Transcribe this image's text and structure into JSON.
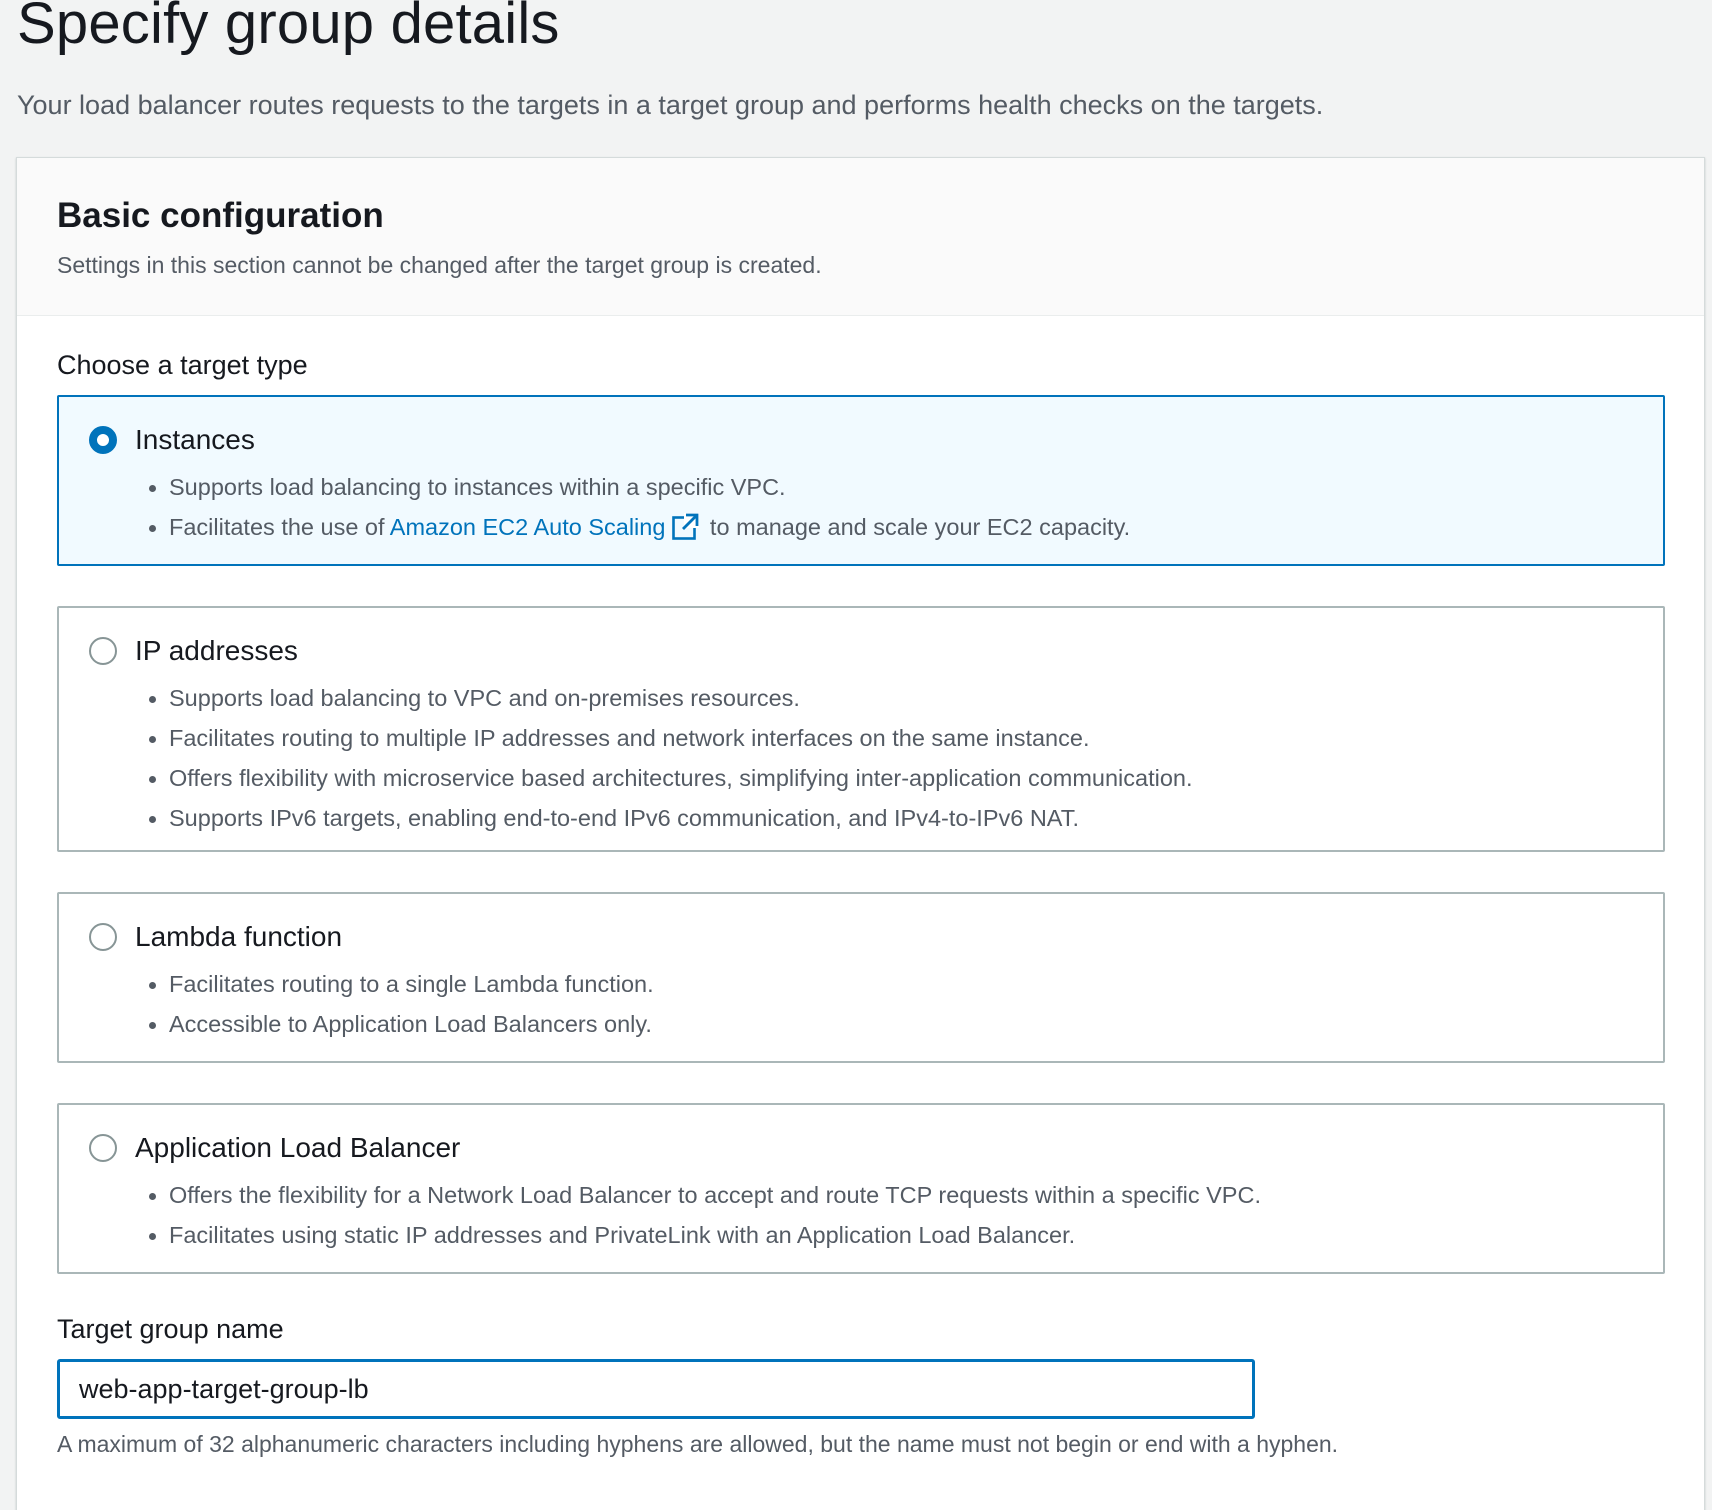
{
  "page": {
    "title": "Specify group details",
    "description": "Your load balancer routes requests to the targets in a target group and performs health checks on the targets."
  },
  "basic_config": {
    "title": "Basic configuration",
    "subtitle": "Settings in this section cannot be changed after the target group is created.",
    "target_type_label": "Choose a target type",
    "options": [
      {
        "title": "Instances",
        "selected": true,
        "bullets": [
          "Supports load balancing to instances within a specific VPC."
        ],
        "link_bullet": {
          "before": "Facilitates the use of ",
          "link": "Amazon EC2 Auto Scaling",
          "after": " to manage and scale your EC2 capacity."
        }
      },
      {
        "title": "IP addresses",
        "selected": false,
        "bullets": [
          "Supports load balancing to VPC and on-premises resources.",
          "Facilitates routing to multiple IP addresses and network interfaces on the same instance.",
          "Offers flexibility with microservice based architectures, simplifying inter-application communication.",
          "Supports IPv6 targets, enabling end-to-end IPv6 communication, and IPv4-to-IPv6 NAT."
        ]
      },
      {
        "title": "Lambda function",
        "selected": false,
        "bullets": [
          "Facilitates routing to a single Lambda function.",
          "Accessible to Application Load Balancers only."
        ]
      },
      {
        "title": "Application Load Balancer",
        "selected": false,
        "bullets": [
          "Offers the flexibility for a Network Load Balancer to accept and route TCP requests within a specific VPC.",
          "Facilitates using static IP addresses and PrivateLink with an Application Load Balancer."
        ]
      }
    ],
    "target_group_name_label": "Target group name",
    "target_group_name_value": "web-app-target-group-lb",
    "target_group_name_constraint": "A maximum of 32 alphanumeric characters including hyphens are allowed, but the name must not begin or end with a hyphen."
  },
  "colors": {
    "accent": "#0073bb",
    "selected_bg": "#f1faff",
    "page_bg": "#f2f3f3"
  },
  "icons": {
    "external_link": "external-link-icon"
  }
}
